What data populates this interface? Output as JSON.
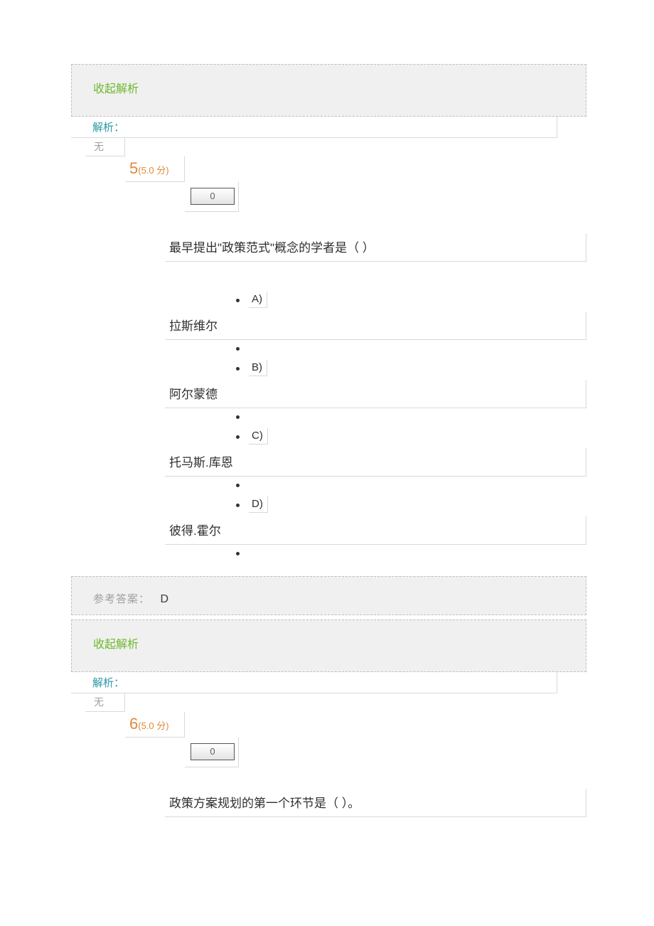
{
  "ui": {
    "collapse_label": "收起解析",
    "analysis_label": "解析：",
    "analysis_none": "无",
    "answer_label": "参考答案：",
    "score_box": "0"
  },
  "q5": {
    "number": "5",
    "points": "(5.0 分)",
    "stem": "最早提出\"政策范式\"概念的学者是（ ）",
    "options": {
      "A": {
        "letter": "A)",
        "text": "拉斯维尔"
      },
      "B": {
        "letter": "B)",
        "text": "阿尔蒙德"
      },
      "C": {
        "letter": "C)",
        "text": "托马斯.库恩"
      },
      "D": {
        "letter": "D)",
        "text": "彼得.霍尔"
      }
    },
    "answer": "D"
  },
  "q6": {
    "number": "6",
    "points": "(5.0 分)",
    "stem": "政策方案规划的第一个环节是（ ）。"
  }
}
